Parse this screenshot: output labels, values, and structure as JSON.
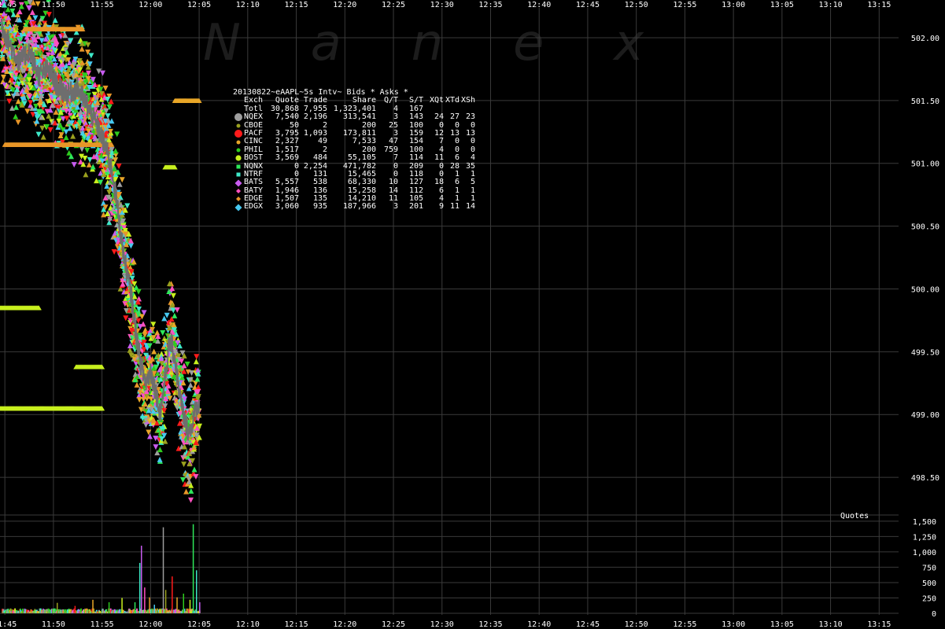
{
  "watermark": [
    "N",
    "a",
    "n",
    "e",
    "x"
  ],
  "stats_panel": {
    "title": "20130822~eAAPL~5s Intv~ Bids * Asks *",
    "headers": [
      "Exch",
      "Quote",
      "Trade",
      "Share",
      "Q/T",
      "S/T",
      "XQt",
      "XTd",
      "XSh"
    ],
    "rows": [
      {
        "exch": "Totl",
        "quote": "30,868",
        "trade": "7,955",
        "share": "1,323,401",
        "qt": "4",
        "st": "167",
        "xqt": "",
        "xtd": "",
        "xsh": "",
        "color": "",
        "marker": "none"
      },
      {
        "exch": "NQEX",
        "quote": "7,540",
        "trade": "2,196",
        "share": "313,541",
        "qt": "3",
        "st": "143",
        "xqt": "24",
        "xtd": "27",
        "xsh": "23",
        "color": "#9e9e9e",
        "marker": "circle-big"
      },
      {
        "exch": "CBOE",
        "quote": "50",
        "trade": "2",
        "share": "200",
        "qt": "25",
        "st": "100",
        "xqt": "0",
        "xtd": "0",
        "xsh": "0",
        "color": "#9aa01e",
        "marker": "circle-small"
      },
      {
        "exch": "PACF",
        "quote": "3,795",
        "trade": "1,093",
        "share": "173,811",
        "qt": "3",
        "st": "159",
        "xqt": "12",
        "xtd": "13",
        "xsh": "13",
        "color": "#ff1a1a",
        "marker": "circle-big"
      },
      {
        "exch": "CINC",
        "quote": "2,327",
        "trade": "49",
        "share": "7,533",
        "qt": "47",
        "st": "154",
        "xqt": "7",
        "xtd": "0",
        "xsh": "0",
        "color": "#e8a628",
        "marker": "circle-small"
      },
      {
        "exch": "PHIL",
        "quote": "1,517",
        "trade": "2",
        "share": "200",
        "qt": "759",
        "st": "100",
        "xqt": "4",
        "xtd": "0",
        "xsh": "0",
        "color": "#2ecc1e",
        "marker": "circle-small"
      },
      {
        "exch": "BOST",
        "quote": "3,569",
        "trade": "484",
        "share": "55,105",
        "qt": "7",
        "st": "114",
        "xqt": "11",
        "xtd": "6",
        "xsh": "4",
        "color": "#c8f01e",
        "marker": "circle-med"
      },
      {
        "exch": "NQNX",
        "quote": "0",
        "trade": "2,254",
        "share": "471,782",
        "qt": "0",
        "st": "209",
        "xqt": "0",
        "xtd": "28",
        "xsh": "35",
        "color": "#2ee85a",
        "marker": "square"
      },
      {
        "exch": "NTRF",
        "quote": "0",
        "trade": "131",
        "share": "15,465",
        "qt": "0",
        "st": "118",
        "xqt": "0",
        "xtd": "1",
        "xsh": "1",
        "color": "#3ee8c8",
        "marker": "square"
      },
      {
        "exch": "BATS",
        "quote": "5,557",
        "trade": "538",
        "share": "68,330",
        "qt": "10",
        "st": "127",
        "xqt": "18",
        "xtd": "6",
        "xsh": "5",
        "color": "#c85cf0",
        "marker": "diamond"
      },
      {
        "exch": "BATY",
        "quote": "1,946",
        "trade": "136",
        "share": "15,258",
        "qt": "14",
        "st": "112",
        "xqt": "6",
        "xtd": "1",
        "xsh": "1",
        "color": "#ff50c0",
        "marker": "diamond-small"
      },
      {
        "exch": "EDGE",
        "quote": "1,507",
        "trade": "135",
        "share": "14,210",
        "qt": "11",
        "st": "105",
        "xqt": "4",
        "xtd": "1",
        "xsh": "1",
        "color": "#e89628",
        "marker": "diamond-small"
      },
      {
        "exch": "EDGX",
        "quote": "3,060",
        "trade": "935",
        "share": "187,966",
        "qt": "3",
        "st": "201",
        "xqt": "9",
        "xtd": "11",
        "xsh": "14",
        "color": "#46c8f0",
        "marker": "diamond"
      }
    ]
  },
  "chart_data": [
    {
      "type": "scatter",
      "title": "",
      "x_tick_labels": [
        "11:45",
        "11:50",
        "11:55",
        "12:00",
        "12:05",
        "12:10",
        "12:15",
        "12:20",
        "12:25",
        "12:30",
        "12:35",
        "12:40",
        "12:45",
        "12:50",
        "12:55",
        "13:00",
        "13:05",
        "13:10",
        "13:15"
      ],
      "x_range": [
        "11:44:30",
        "13:17:00"
      ],
      "y_tick_labels": [
        "502.00",
        "501.50",
        "501.00",
        "500.50",
        "500.00",
        "499.50",
        "499.00",
        "498.50"
      ],
      "y_ticks": [
        502.0,
        501.5,
        501.0,
        500.5,
        500.0,
        499.5,
        499.0,
        498.5
      ],
      "ylim": [
        498.2,
        502.25
      ],
      "grid": true,
      "series_keys": [
        "NQEX",
        "CBOE",
        "PACF",
        "CINC",
        "PHIL",
        "BOST",
        "NQNX",
        "NTRF",
        "BATS",
        "BATY",
        "EDGE",
        "EDGX"
      ],
      "price_path_nbbo": [
        [
          "11:44:40",
          502.1
        ],
        [
          "11:45:30",
          501.95
        ],
        [
          "11:46:30",
          501.8
        ],
        [
          "11:47:30",
          501.9
        ],
        [
          "11:48:30",
          501.7
        ],
        [
          "11:49:30",
          501.75
        ],
        [
          "11:50:30",
          501.6
        ],
        [
          "11:51:30",
          501.55
        ],
        [
          "11:52:30",
          501.6
        ],
        [
          "11:53:30",
          501.45
        ],
        [
          "11:54:30",
          501.3
        ],
        [
          "11:55:30",
          501.1
        ],
        [
          "11:56:00",
          500.95
        ],
        [
          "11:56:30",
          500.7
        ],
        [
          "11:57:00",
          500.4
        ],
        [
          "11:57:30",
          500.15
        ],
        [
          "11:58:00",
          499.95
        ],
        [
          "11:58:30",
          499.65
        ],
        [
          "11:59:00",
          499.4
        ],
        [
          "11:59:30",
          499.25
        ],
        [
          "12:00:00",
          499.35
        ],
        [
          "12:00:30",
          499.2
        ],
        [
          "12:01:00",
          499.0
        ],
        [
          "12:01:30",
          499.3
        ],
        [
          "12:02:00",
          499.6
        ],
        [
          "12:02:30",
          499.45
        ],
        [
          "12:03:00",
          499.15
        ],
        [
          "12:03:30",
          498.95
        ],
        [
          "12:04:00",
          498.85
        ],
        [
          "12:04:30",
          499.0
        ],
        [
          "12:05:00",
          499.1
        ]
      ],
      "flat_quote_levels": [
        {
          "exch": "BOST",
          "price": 499.85,
          "from": "11:44:30",
          "to": "11:48:30"
        },
        {
          "exch": "BOST",
          "price": 499.38,
          "from": "11:52:20",
          "to": "11:55:00"
        },
        {
          "exch": "BOST",
          "price": 499.05,
          "from": "11:44:30",
          "to": "11:55:00"
        },
        {
          "exch": "BOST",
          "price": 500.97,
          "from": "12:01:30",
          "to": "12:02:30"
        },
        {
          "exch": "CINC",
          "price": 501.5,
          "from": "12:02:30",
          "to": "12:05:00"
        },
        {
          "exch": "EDGE",
          "price": 501.15,
          "from": "11:45:00",
          "to": "11:56:00"
        },
        {
          "exch": "EDGE",
          "price": 502.07,
          "from": "11:47:00",
          "to": "11:53:00"
        }
      ]
    },
    {
      "type": "bar",
      "title": "Quotes",
      "y_tick_labels": [
        "1,500",
        "1,250",
        "1,000",
        "750",
        "500",
        "250",
        "0"
      ],
      "y_ticks": [
        1500,
        1250,
        1000,
        750,
        500,
        250,
        0
      ],
      "ylim": [
        0,
        1600
      ],
      "x_range": [
        "11:44:30",
        "13:17:00"
      ],
      "grid": true,
      "spikes": [
        [
          "11:45:10",
          60
        ],
        [
          "11:50:20",
          170
        ],
        [
          "11:52:10",
          120
        ],
        [
          "11:54:00",
          220
        ],
        [
          "11:55:40",
          180
        ],
        [
          "11:57:00",
          250
        ],
        [
          "11:58:20",
          180
        ],
        [
          "11:58:50",
          820
        ],
        [
          "11:59:00",
          1100
        ],
        [
          "11:59:20",
          420
        ],
        [
          "11:59:50",
          260
        ],
        [
          "12:00:20",
          140
        ],
        [
          "12:01:15",
          1400
        ],
        [
          "12:01:30",
          380
        ],
        [
          "12:02:10",
          600
        ],
        [
          "12:02:40",
          260
        ],
        [
          "12:03:20",
          320
        ],
        [
          "12:04:00",
          220
        ],
        [
          "12:04:20",
          1450
        ],
        [
          "12:04:40",
          700
        ],
        [
          "12:05:00",
          180
        ]
      ]
    }
  ]
}
